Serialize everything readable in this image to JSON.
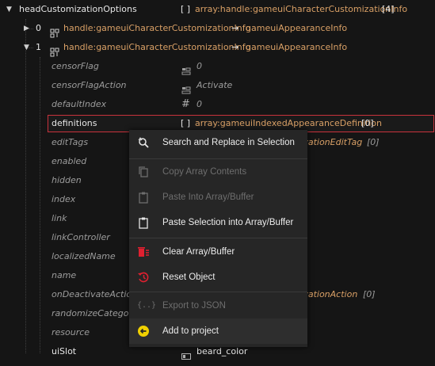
{
  "root": {
    "name": "headCustomizationOptions",
    "brackets": "[ ]",
    "type": "array:handle:gameuiCharacterCustomizationInfo",
    "count": "[4]"
  },
  "items": [
    {
      "index": "0",
      "handle": "handle:gameuiCharacterCustomizationInfo",
      "arrow": "→",
      "target": "gameuiAppearanceInfo"
    },
    {
      "index": "1",
      "handle": "handle:gameuiCharacterCustomizationInfo",
      "arrow": "→",
      "target": "gameuiAppearanceInfo"
    }
  ],
  "fields": {
    "censorFlag": {
      "name": "censorFlag",
      "value": "0"
    },
    "censorFlagAction": {
      "name": "censorFlagAction",
      "value": "Activate"
    },
    "defaultIndex": {
      "name": "defaultIndex",
      "value": "0"
    },
    "definitions": {
      "name": "definitions",
      "brackets": "[ ]",
      "type": "array:gameuiIndexedAppearanceDefinition",
      "count": "[0]"
    },
    "editTags": {
      "name": "editTags",
      "type": "izationEditTag",
      "count": "[0]"
    },
    "enabled": {
      "name": "enabled"
    },
    "hidden": {
      "name": "hidden"
    },
    "index": {
      "name": "index"
    },
    "link": {
      "name": "link"
    },
    "linkController": {
      "name": "linkController"
    },
    "localizedName": {
      "name": "localizedName"
    },
    "name": {
      "name": "name"
    },
    "onDeactivateActions": {
      "name": "onDeactivateActions",
      "type": "izationAction",
      "count": "[0]"
    },
    "randomizeCategory": {
      "name": "randomizeCategory"
    },
    "resource": {
      "name": "resource"
    },
    "uiSlot": {
      "name": "uiSlot",
      "value": "beard_color"
    }
  },
  "menu": {
    "search_replace": "Search and Replace in Selection",
    "copy_array": "Copy Array Contents",
    "paste_into": "Paste Into Array/Buffer",
    "paste_selection": "Paste Selection into Array/Buffer",
    "clear_array": "Clear Array/Buffer",
    "reset_object": "Reset Object",
    "export_json": "Export to JSON",
    "add_project": "Add to project"
  },
  "colors": {
    "accent_red": "#c8323c",
    "warning_red": "#e02030",
    "add_yellow": "#f0d000"
  }
}
